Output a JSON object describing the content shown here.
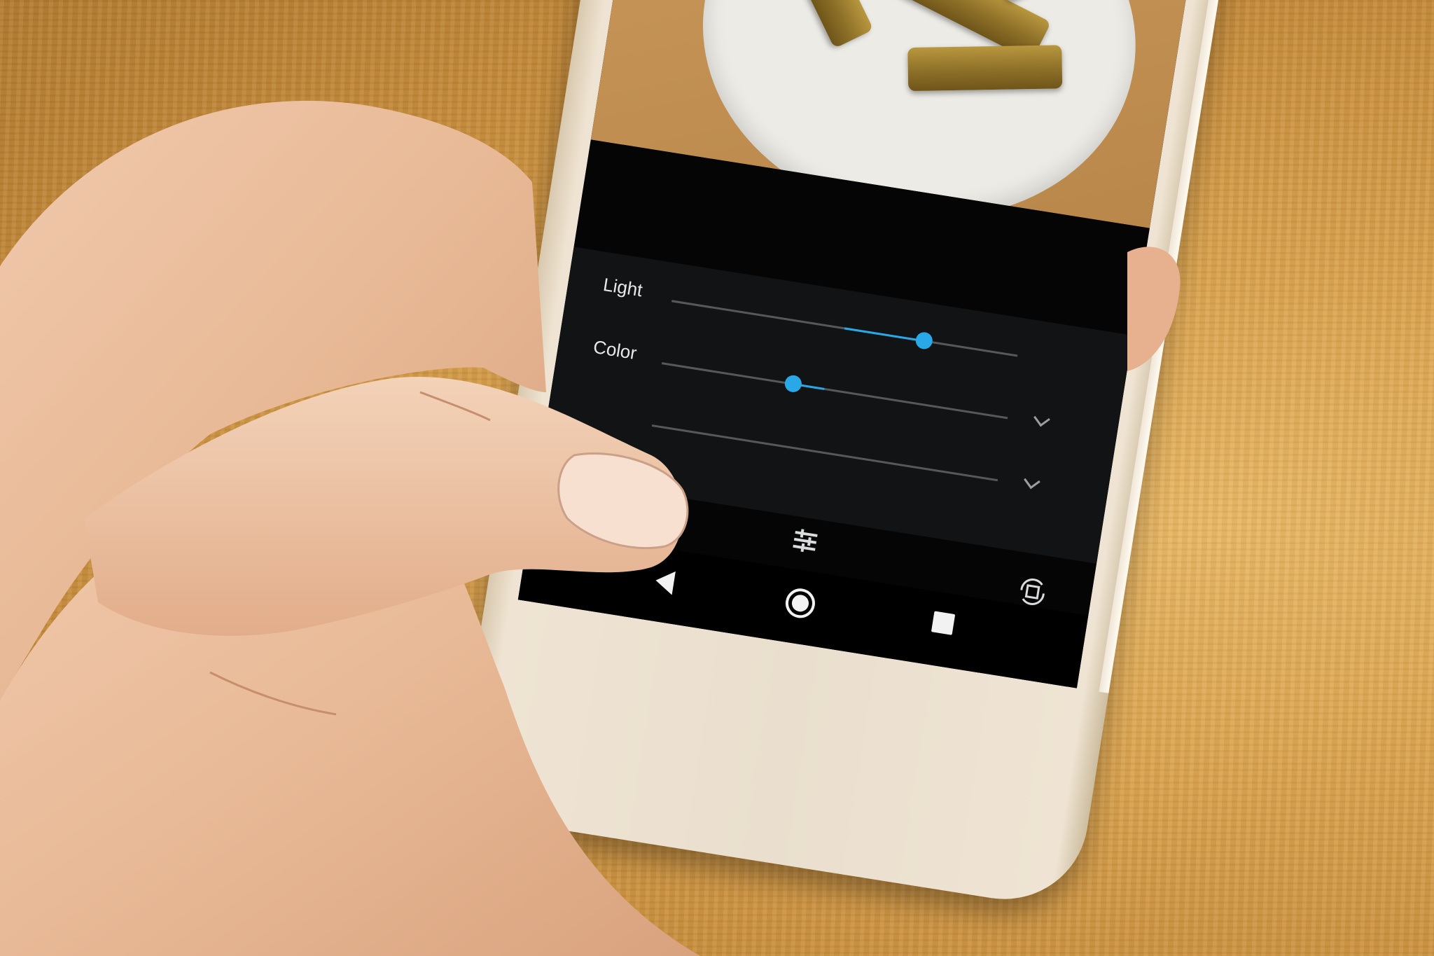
{
  "photo_editor": {
    "sliders": [
      {
        "label": "Light",
        "value_fraction": 0.73
      },
      {
        "label": "Color",
        "value_fraction": 0.38
      },
      {
        "label": "",
        "value_fraction": null
      }
    ],
    "toolbar": {
      "adjust_icon": "sliders-icon",
      "crop_rotate_icon": "crop-rotate-icon"
    }
  },
  "android_nav": {
    "back_icon": "back-triangle-icon",
    "home_icon": "home-circle-icon",
    "recents_icon": "recents-square-icon"
  },
  "colors": {
    "accent": "#29a8e8",
    "phone_body": "#eadfce",
    "table_wood": "#d9a24e"
  }
}
